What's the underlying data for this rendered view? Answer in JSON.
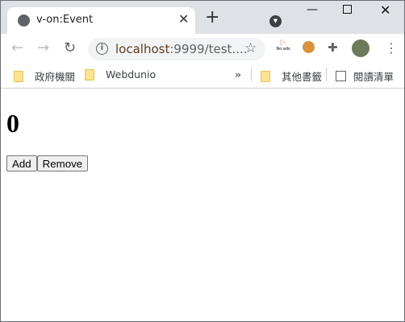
{
  "browser": {
    "tab_title": "v-on:Event",
    "url_host": "localhost",
    "url_rest": ":9999/test....",
    "extensions": {
      "noads_label": "No ads"
    },
    "bookmarks": [
      {
        "label": "政府機關"
      },
      {
        "label": "Webdunio"
      }
    ],
    "overflow": "»",
    "other_bookmarks": "其他書籤",
    "reading_list": "閱讀清單"
  },
  "page": {
    "counter": "0",
    "add_label": "Add",
    "remove_label": "Remove"
  }
}
